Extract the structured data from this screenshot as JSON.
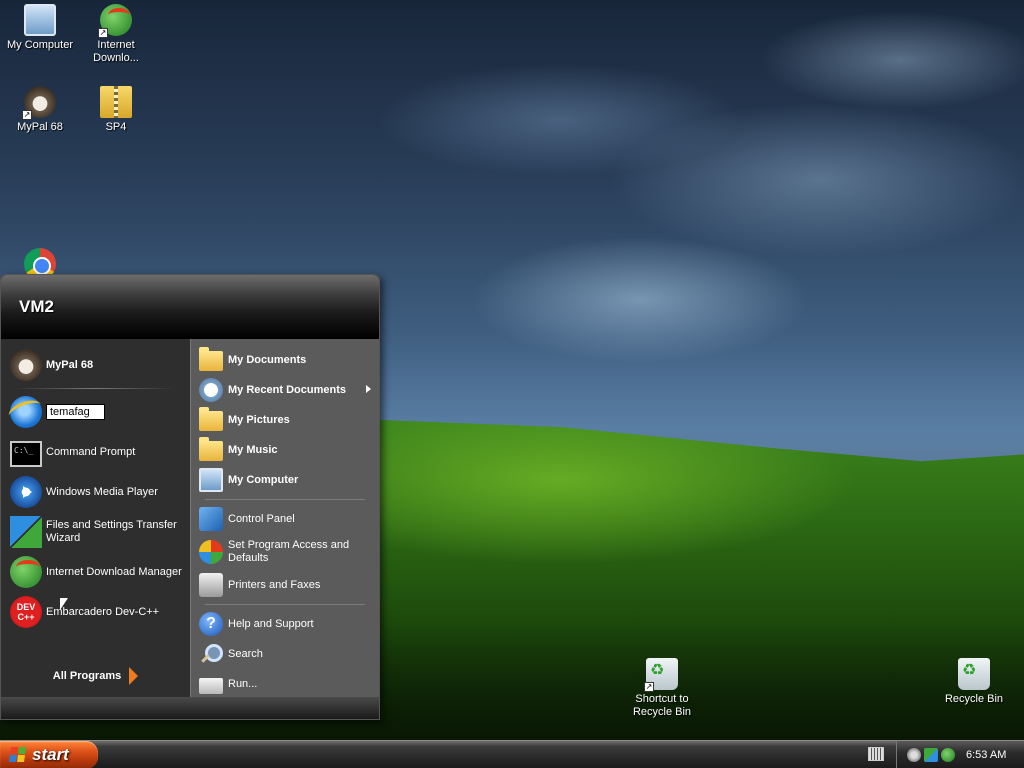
{
  "desktop": {
    "icons": [
      {
        "label": "My Computer",
        "icon": "computer-icon"
      },
      {
        "label": "Internet Downlo...",
        "icon": "idm-icon"
      },
      {
        "label": "MyPal 68",
        "icon": "raccoon-icon"
      },
      {
        "label": "SP4",
        "icon": "zip-folder-icon"
      },
      {
        "label": "",
        "icon": "chrome-icon"
      },
      {
        "label": "Shortcut to Recycle Bin",
        "icon": "recycle-bin-icon"
      },
      {
        "label": "Recycle Bin",
        "icon": "recycle-bin-icon"
      }
    ]
  },
  "start_menu": {
    "user": "VM2",
    "left_items": [
      {
        "label": "MyPal 68",
        "icon": "raccoon-icon",
        "bold": true
      },
      {
        "label": "temafag",
        "icon": "ie-icon",
        "renaming": true
      },
      {
        "label": "Command Prompt",
        "icon": "cmd-icon"
      },
      {
        "label": "Windows Media Player",
        "icon": "wmp-icon"
      },
      {
        "label": "Files and Settings Transfer Wizard",
        "icon": "transfer-wizard-icon"
      },
      {
        "label": "Internet Download Manager",
        "icon": "idm-icon"
      },
      {
        "label": "Embarcadero Dev-C++",
        "icon": "devcpp-icon"
      }
    ],
    "all_programs": "All Programs",
    "right_items": [
      {
        "label": "My Documents",
        "icon": "folder-icon",
        "bold": true
      },
      {
        "label": "My Recent Documents",
        "icon": "recent-docs-icon",
        "bold": true,
        "submenu": true
      },
      {
        "label": "My Pictures",
        "icon": "folder-icon",
        "bold": true
      },
      {
        "label": "My Music",
        "icon": "folder-icon",
        "bold": true
      },
      {
        "label": "My Computer",
        "icon": "computer-icon",
        "bold": true
      },
      {
        "label": "Control Panel",
        "icon": "control-panel-icon"
      },
      {
        "label": "Set Program Access and Defaults",
        "icon": "set-program-icon"
      },
      {
        "label": "Printers and Faxes",
        "icon": "printer-icon"
      },
      {
        "label": "Help and Support",
        "icon": "help-icon"
      },
      {
        "label": "Search",
        "icon": "search-icon"
      },
      {
        "label": "Run...",
        "icon": "run-icon"
      }
    ]
  },
  "taskbar": {
    "start_label": "start",
    "clock": "6:53 AM"
  },
  "devcpp_icon_text": "DEV C++"
}
